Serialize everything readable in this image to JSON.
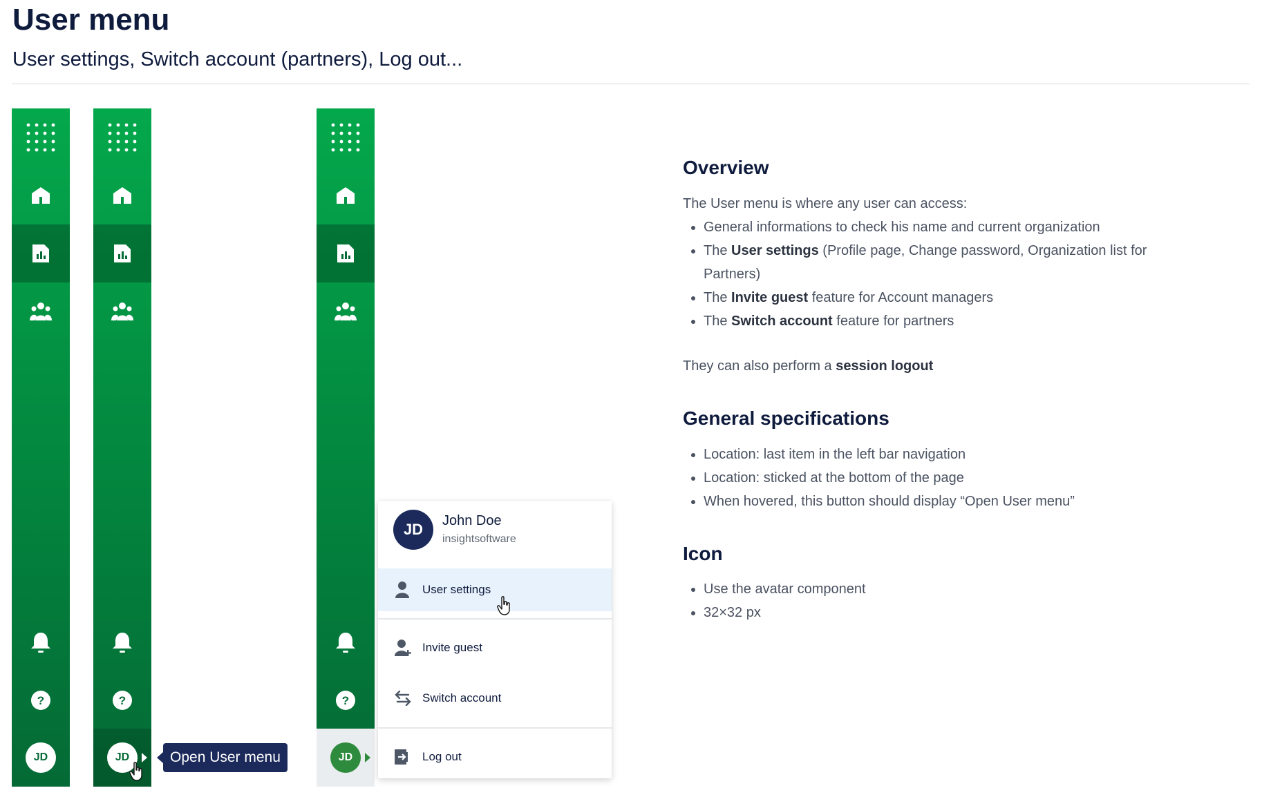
{
  "header": {
    "title": "User menu",
    "subtitle": "User settings, Switch account (partners), Log out..."
  },
  "colors": {
    "nav_green": "#039243",
    "nav_green_dark": "#046a35",
    "tooltip_bg": "#1b2a5b",
    "avatar_dark": "#1b2a5b",
    "menu_hover": "#e8f2fc"
  },
  "nav": {
    "icons": [
      "apps-grid-icon",
      "home-icon",
      "report-chart-icon",
      "team-icon",
      "bell-icon",
      "help-icon"
    ],
    "avatar_initials": "JD"
  },
  "tooltip": {
    "text": "Open User menu"
  },
  "user_menu": {
    "initials": "JD",
    "name": "John Doe",
    "organization": "insightsoftware",
    "items": [
      {
        "label": "User settings",
        "icon": "user-icon"
      },
      {
        "label": "Invite guest",
        "icon": "add-user-icon"
      },
      {
        "label": "Switch account",
        "icon": "switch-arrows-icon"
      },
      {
        "label": "Log out",
        "icon": "logout-icon"
      }
    ]
  },
  "overview": {
    "heading": "Overview",
    "intro": "The User menu is where any user can access:",
    "bullets": [
      {
        "before": "General informations to check his name and current organization",
        "bold": "",
        "after": ""
      },
      {
        "before": "The ",
        "bold": "User settings",
        "after": " (Profile page, Change password, Organization list for Partners)"
      },
      {
        "before": "The ",
        "bold": "Invite guest",
        "after": " feature for Account managers"
      },
      {
        "before": "The ",
        "bold": "Switch account",
        "after": " feature for partners"
      }
    ],
    "logout_before": "They can also perform a ",
    "logout_bold": "session logout"
  },
  "general_specifications": {
    "heading": "General specifications",
    "bullets": [
      "Location: last item in the left bar navigation",
      "Location: sticked at the bottom of the page",
      "When hovered, this button should display “Open User menu”"
    ]
  },
  "icon_section": {
    "heading": "Icon",
    "bullets": [
      "Use the avatar component",
      "32×32 px"
    ]
  }
}
